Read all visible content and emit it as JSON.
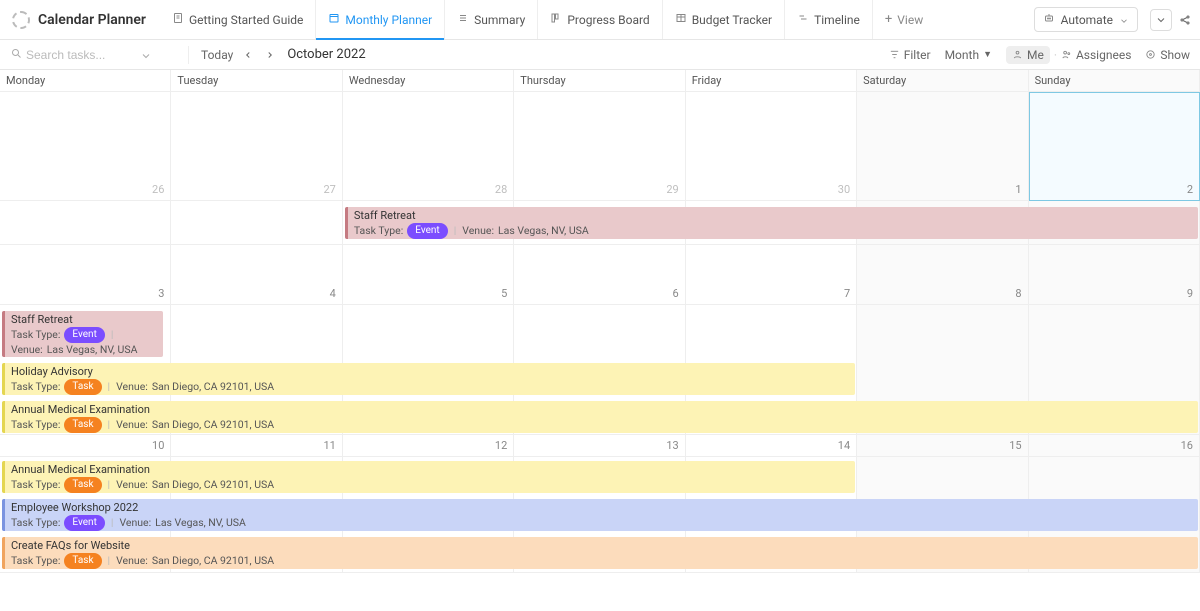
{
  "header": {
    "app_title": "Calendar Planner",
    "tabs": [
      {
        "label": "Getting Started Guide"
      },
      {
        "label": "Monthly Planner"
      },
      {
        "label": "Summary"
      },
      {
        "label": "Progress Board"
      },
      {
        "label": "Budget Tracker"
      },
      {
        "label": "Timeline"
      }
    ],
    "add_view": "View",
    "automate": "Automate"
  },
  "toolbar": {
    "search_placeholder": "Search tasks...",
    "today": "Today",
    "month_label": "October 2022",
    "filter": "Filter",
    "month_dropdown": "Month",
    "me": "Me",
    "assignees": "Assignees",
    "show": "Show"
  },
  "daynames": [
    "Monday",
    "Tuesday",
    "Wednesday",
    "Thursday",
    "Friday",
    "Saturday",
    "Sunday"
  ],
  "weeks": [
    {
      "days": [
        {
          "num": "26",
          "muted": true
        },
        {
          "num": "27",
          "muted": true
        },
        {
          "num": "28",
          "muted": true
        },
        {
          "num": "29",
          "muted": true
        },
        {
          "num": "30",
          "muted": true
        },
        {
          "num": "1"
        },
        {
          "num": "2",
          "today": true
        }
      ]
    },
    {
      "days": [
        {
          "num": "3"
        },
        {
          "num": "4"
        },
        {
          "num": "5"
        },
        {
          "num": "6"
        },
        {
          "num": "7"
        },
        {
          "num": "8"
        },
        {
          "num": "9"
        }
      ]
    },
    {
      "days": [
        {
          "num": "10"
        },
        {
          "num": "11"
        },
        {
          "num": "12"
        },
        {
          "num": "13"
        },
        {
          "num": "14"
        },
        {
          "num": "15"
        },
        {
          "num": "16"
        }
      ]
    }
  ],
  "labels": {
    "task_type": "Task Type:",
    "venue": "Venue:",
    "pill_event": "Event",
    "pill_task": "Task"
  },
  "events": {
    "staff_retreat_wk1": {
      "title": "Staff Retreat",
      "venue": "Las Vegas, NV, USA",
      "type": "Event"
    },
    "staff_retreat_wk2": {
      "title": "Staff Retreat",
      "venue": "Las Vegas, NV, USA",
      "type": "Event"
    },
    "holiday_advisory": {
      "title": "Holiday Advisory",
      "venue": "San Diego, CA 92101, USA",
      "type": "Task"
    },
    "annual_med_wk2": {
      "title": "Annual Medical Examination",
      "venue": "San Diego, CA 92101, USA",
      "type": "Task"
    },
    "annual_med_wk3": {
      "title": "Annual Medical Examination",
      "venue": "San Diego, CA 92101, USA",
      "type": "Task"
    },
    "workshop": {
      "title": "Employee Workshop 2022",
      "venue": "Las Vegas, NV, USA",
      "type": "Event"
    },
    "faqs": {
      "title": "Create FAQs for Website",
      "venue": "San Diego, CA 92101, USA",
      "type": "Task"
    }
  }
}
